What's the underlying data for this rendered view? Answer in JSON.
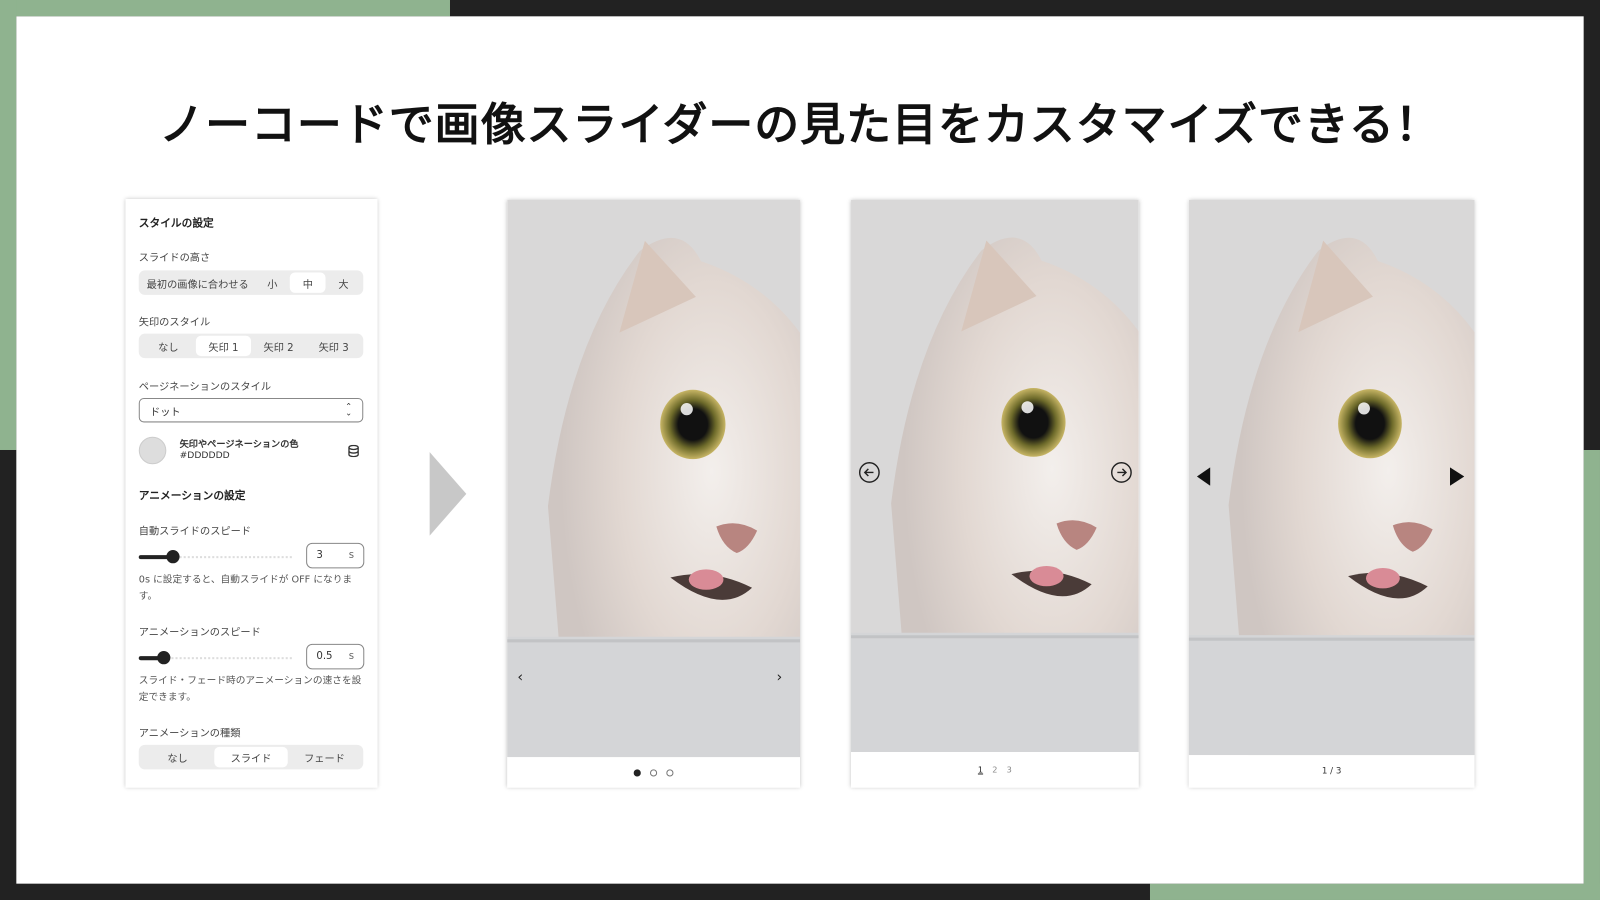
{
  "title": "ノーコードで画像スライダーの見た目をカスタマイズできる！",
  "panel": {
    "style_heading": "スタイルの設定",
    "slide_height": {
      "label": "スライドの高さ",
      "options": [
        "最初の画像に合わせる",
        "小",
        "中",
        "大"
      ],
      "selected": "中"
    },
    "arrow_style": {
      "label": "矢印のスタイル",
      "options": [
        "なし",
        "矢印 1",
        "矢印 2",
        "矢印 3"
      ],
      "selected": "矢印 1"
    },
    "pagination_style": {
      "label": "ページネーションのスタイル",
      "value": "ドット"
    },
    "color": {
      "label": "矢印やページネーションの色",
      "value": "#DDDDDD",
      "swatch": "#dddddd",
      "icon": "database-icon"
    },
    "animation_heading": "アニメーションの設定",
    "auto_speed": {
      "label": "自動スライドのスピード",
      "value": "3",
      "unit": "s",
      "level": 0.2,
      "help": "0s に設定すると、自動スライドが OFF になります。"
    },
    "anim_speed": {
      "label": "アニメーションのスピード",
      "value": "0.5",
      "unit": "s",
      "level": 0.14,
      "help": "スライド・フェード時のアニメーションの速さを設定できます。"
    },
    "anim_type": {
      "label": "アニメーションの種類",
      "options": [
        "なし",
        "スライド",
        "フェード"
      ],
      "selected": "スライド"
    }
  },
  "previews": [
    {
      "arrow": "chevron",
      "pagination": "dots",
      "pages": 3,
      "current": 1
    },
    {
      "arrow": "circle-arrow",
      "pagination": "numbers",
      "numbers": [
        "1",
        "2",
        "3"
      ]
    },
    {
      "arrow": "triangle",
      "pagination": "fraction",
      "fraction": "1 / 3"
    }
  ],
  "colors": {
    "accent_green": "#8fb38f",
    "dark": "#222222"
  }
}
